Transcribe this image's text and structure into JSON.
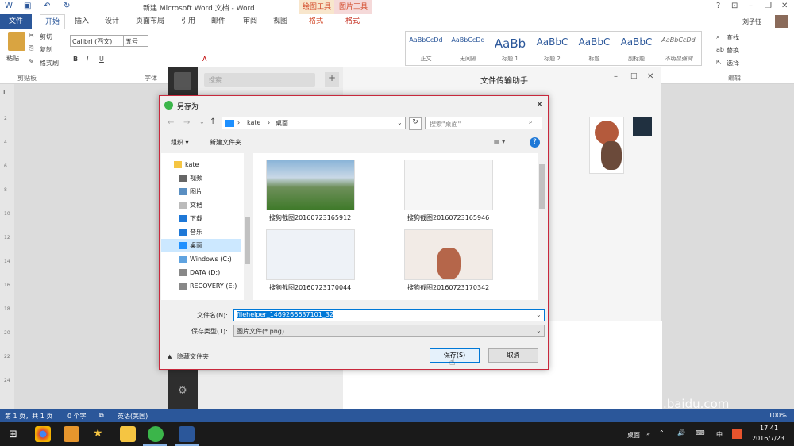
{
  "word": {
    "title": "新建 Microsoft Word 文档 - Word",
    "context_tabs": [
      "绘图工具",
      "图片工具"
    ],
    "user": "刘子钰",
    "tabs": [
      "文件",
      "开始",
      "插入",
      "设计",
      "页面布局",
      "引用",
      "邮件",
      "审阅",
      "视图",
      "格式",
      "格式"
    ],
    "clipboard": {
      "paste": "粘贴",
      "cut": "剪切",
      "copy": "复制",
      "format_painter": "格式刷",
      "label": "剪贴板"
    },
    "font": {
      "name": "Calibri (西文)",
      "size": "五号",
      "label": "字体"
    },
    "styles": [
      {
        "preview": "AaBbCcDd",
        "name": "正文"
      },
      {
        "preview": "AaBbCcDd",
        "name": "无间隔"
      },
      {
        "preview": "AaBb",
        "name": "标题 1"
      },
      {
        "preview": "AaBbC",
        "name": "标题 2"
      },
      {
        "preview": "AaBbC",
        "name": "标题"
      },
      {
        "preview": "AaBbC",
        "name": "副标题"
      },
      {
        "preview": "AaBbCcDd",
        "name": "不明显强调"
      }
    ],
    "editing": {
      "find": "查找",
      "replace": "替换",
      "select": "选择",
      "label": "编辑"
    },
    "ruler_numbers": [
      "2",
      "4",
      "6",
      "8",
      "10",
      "12",
      "14",
      "16",
      "18",
      "20",
      "22",
      "24"
    ],
    "status": {
      "page": "第 1 页，共 1 页",
      "words": "0 个字",
      "lang": "英语(美国)",
      "zoom": "100%"
    }
  },
  "wechat": {
    "search_placeholder": "搜索",
    "chat_title": "文件传输助手"
  },
  "dialog": {
    "title": "另存为",
    "path": [
      "kate",
      "桌面"
    ],
    "search_placeholder": "搜索\"桌面\"",
    "organize": "组织 ▾",
    "new_folder": "新建文件夹",
    "tree": [
      "kate",
      "视频",
      "图片",
      "文档",
      "下载",
      "音乐",
      "桌面",
      "Windows (C:)",
      "DATA (D:)",
      "RECOVERY (E:)"
    ],
    "files": [
      "搜狗截图20160723165912",
      "搜狗截图20160723165946",
      "搜狗截图20160723170044",
      "搜狗截图20160723170342"
    ],
    "filename_label": "文件名(N):",
    "filename_value": "filehelper_1469266637101_32",
    "filetype_label": "保存类型(T):",
    "filetype_value": "图片文件(*.png)",
    "hide_folders": "隐藏文件夹",
    "save": "保存(S)",
    "cancel": "取消"
  },
  "taskbar": {
    "desktop": "桌面",
    "ime": "中",
    "time": "17:41",
    "date": "2016/7/23"
  },
  "watermark": {
    "text": "jingyan.baidu.com"
  }
}
